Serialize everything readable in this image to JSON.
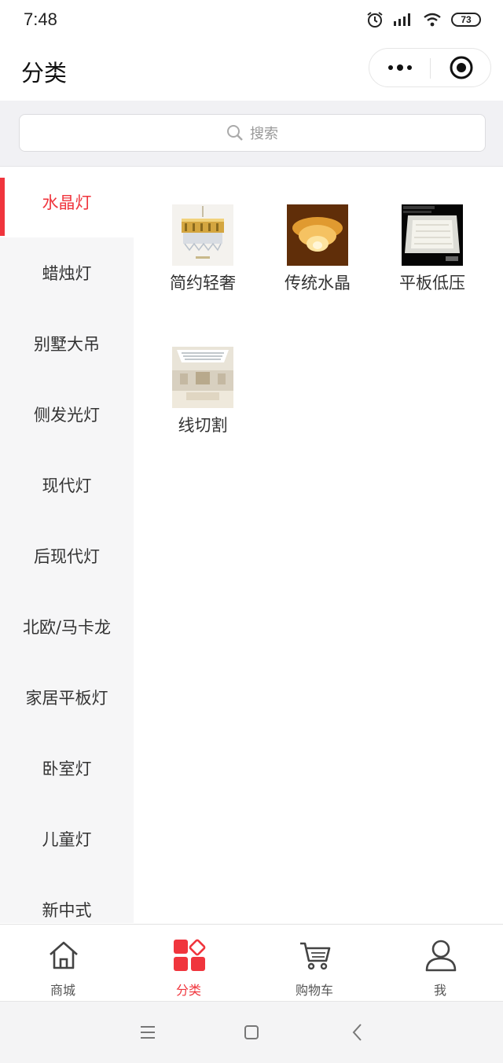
{
  "status": {
    "time": "7:48",
    "battery": "73"
  },
  "nav": {
    "title": "分类"
  },
  "search": {
    "placeholder": "搜索"
  },
  "sidebar": {
    "items": [
      {
        "label": "水晶灯",
        "active": true
      },
      {
        "label": "蜡烛灯"
      },
      {
        "label": "别墅大吊"
      },
      {
        "label": "侧发光灯"
      },
      {
        "label": "现代灯"
      },
      {
        "label": "后现代灯"
      },
      {
        "label": "北欧/马卡龙"
      },
      {
        "label": "家居平板灯"
      },
      {
        "label": "卧室灯"
      },
      {
        "label": "儿童灯"
      },
      {
        "label": "新中式"
      }
    ]
  },
  "products": [
    {
      "label": "简约轻奢",
      "icon": "gold-crystal-chandelier-thumbnail"
    },
    {
      "label": "传统水晶",
      "icon": "crystal-ceiling-lamp-thumbnail"
    },
    {
      "label": "平板低压",
      "icon": "flat-panel-light-thumbnail"
    },
    {
      "label": "线切割",
      "icon": "wire-cut-ceiling-light-thumbnail"
    }
  ],
  "tabs": [
    {
      "label": "商城",
      "icon": "home-icon"
    },
    {
      "label": "分类",
      "icon": "category-icon",
      "active": true
    },
    {
      "label": "购物车",
      "icon": "cart-icon"
    },
    {
      "label": "我",
      "icon": "user-icon"
    }
  ],
  "colors": {
    "accent": "#f0353d",
    "sidebar_bg": "#f6f6f7",
    "search_bg": "#f1f1f4"
  }
}
